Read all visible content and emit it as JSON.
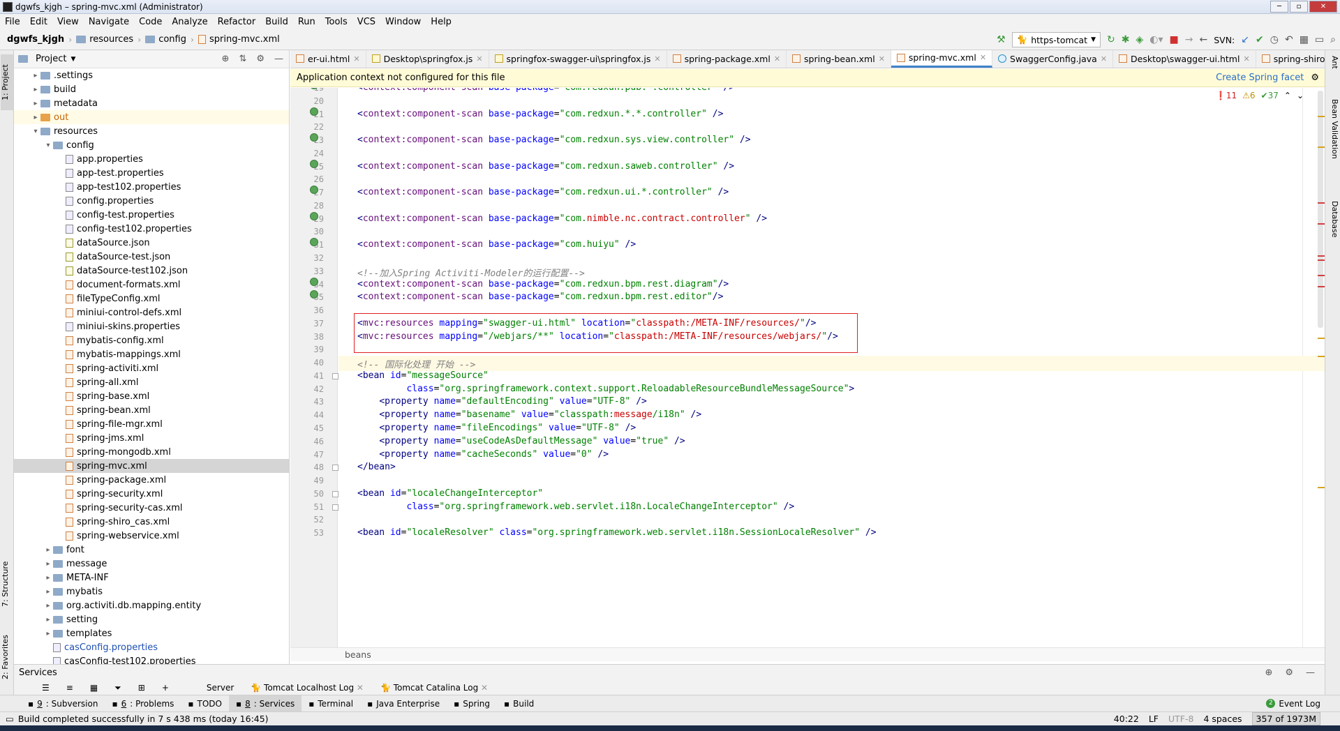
{
  "window": {
    "title": "dgwfs_kjgh – spring-mvc.xml (Administrator)"
  },
  "menu": [
    "File",
    "Edit",
    "View",
    "Navigate",
    "Code",
    "Analyze",
    "Refactor",
    "Build",
    "Run",
    "Tools",
    "VCS",
    "Window",
    "Help"
  ],
  "breadcrumb": {
    "project": "dgwfs_kjgh",
    "items": [
      "resources",
      "config",
      "spring-mvc.xml"
    ]
  },
  "toolbar": {
    "run_config": "https-tomcat",
    "svn_label": "SVN:"
  },
  "left_strip": {
    "project": "1: Project",
    "structure": "7: Structure",
    "favorites": "2: Favorites"
  },
  "right_strip": {
    "ant": "Ant",
    "bean_validation": "Bean Validation",
    "database": "Database"
  },
  "project_panel": {
    "title": "Project",
    "tree": [
      {
        "label": ".settings",
        "depth": 1,
        "type": "folder",
        "arrow": "▸"
      },
      {
        "label": "build",
        "depth": 1,
        "type": "folder",
        "arrow": "▸"
      },
      {
        "label": "metadata",
        "depth": 1,
        "type": "folder",
        "arrow": "▸"
      },
      {
        "label": "out",
        "depth": 1,
        "type": "folder-or",
        "arrow": "▸",
        "cls": "out"
      },
      {
        "label": "resources",
        "depth": 1,
        "type": "folder",
        "arrow": "▾"
      },
      {
        "label": "config",
        "depth": 2,
        "type": "folder",
        "arrow": "▾"
      },
      {
        "label": "app.properties",
        "depth": 3,
        "type": "prop"
      },
      {
        "label": "app-test.properties",
        "depth": 3,
        "type": "prop"
      },
      {
        "label": "app-test102.properties",
        "depth": 3,
        "type": "prop"
      },
      {
        "label": "config.properties",
        "depth": 3,
        "type": "prop"
      },
      {
        "label": "config-test.properties",
        "depth": 3,
        "type": "prop"
      },
      {
        "label": "config-test102.properties",
        "depth": 3,
        "type": "prop"
      },
      {
        "label": "dataSource.json",
        "depth": 3,
        "type": "json"
      },
      {
        "label": "dataSource-test.json",
        "depth": 3,
        "type": "json"
      },
      {
        "label": "dataSource-test102.json",
        "depth": 3,
        "type": "json"
      },
      {
        "label": "document-formats.xml",
        "depth": 3,
        "type": "xml"
      },
      {
        "label": "fileTypeConfig.xml",
        "depth": 3,
        "type": "xml"
      },
      {
        "label": "miniui-control-defs.xml",
        "depth": 3,
        "type": "xml"
      },
      {
        "label": "miniui-skins.properties",
        "depth": 3,
        "type": "prop"
      },
      {
        "label": "mybatis-config.xml",
        "depth": 3,
        "type": "xml"
      },
      {
        "label": "mybatis-mappings.xml",
        "depth": 3,
        "type": "xml"
      },
      {
        "label": "spring-activiti.xml",
        "depth": 3,
        "type": "xml"
      },
      {
        "label": "spring-all.xml",
        "depth": 3,
        "type": "xml"
      },
      {
        "label": "spring-base.xml",
        "depth": 3,
        "type": "xml"
      },
      {
        "label": "spring-bean.xml",
        "depth": 3,
        "type": "xml"
      },
      {
        "label": "spring-file-mgr.xml",
        "depth": 3,
        "type": "xml"
      },
      {
        "label": "spring-jms.xml",
        "depth": 3,
        "type": "xml"
      },
      {
        "label": "spring-mongodb.xml",
        "depth": 3,
        "type": "xml"
      },
      {
        "label": "spring-mvc.xml",
        "depth": 3,
        "type": "xml",
        "cls": "sel"
      },
      {
        "label": "spring-package.xml",
        "depth": 3,
        "type": "xml"
      },
      {
        "label": "spring-security.xml",
        "depth": 3,
        "type": "xml"
      },
      {
        "label": "spring-security-cas.xml",
        "depth": 3,
        "type": "xml"
      },
      {
        "label": "spring-shiro_cas.xml",
        "depth": 3,
        "type": "xml"
      },
      {
        "label": "spring-webservice.xml",
        "depth": 3,
        "type": "xml"
      },
      {
        "label": "font",
        "depth": 2,
        "type": "folder",
        "arrow": "▸"
      },
      {
        "label": "message",
        "depth": 2,
        "type": "folder",
        "arrow": "▸"
      },
      {
        "label": "META-INF",
        "depth": 2,
        "type": "folder",
        "arrow": "▸"
      },
      {
        "label": "mybatis",
        "depth": 2,
        "type": "folder",
        "arrow": "▸"
      },
      {
        "label": "org.activiti.db.mapping.entity",
        "depth": 2,
        "type": "folder",
        "arrow": "▸"
      },
      {
        "label": "setting",
        "depth": 2,
        "type": "folder",
        "arrow": "▸"
      },
      {
        "label": "templates",
        "depth": 2,
        "type": "folder",
        "arrow": "▸"
      },
      {
        "label": "casConfig.properties",
        "depth": 2,
        "type": "prop",
        "cls": "blue"
      },
      {
        "label": "casConfig-test102.properties",
        "depth": 2,
        "type": "prop"
      }
    ]
  },
  "tabs": [
    {
      "label": "er-ui.html",
      "type": "xml"
    },
    {
      "label": "Desktop\\springfox.js",
      "type": "js"
    },
    {
      "label": "springfox-swagger-ui\\springfox.js",
      "type": "js"
    },
    {
      "label": "spring-package.xml",
      "type": "xml"
    },
    {
      "label": "spring-bean.xml",
      "type": "xml"
    },
    {
      "label": "spring-mvc.xml",
      "type": "xml",
      "active": true
    },
    {
      "label": "SwaggerConfig.java",
      "type": "jv"
    },
    {
      "label": "Desktop\\swagger-ui.html",
      "type": "xml"
    },
    {
      "label": "spring-shiro_cas.xml",
      "type": "xml"
    }
  ],
  "banner": {
    "message": "Application context not configured for this file",
    "link": "Create Spring facet"
  },
  "inspections": {
    "errors": "11",
    "warnings": "6",
    "ok": "37"
  },
  "code_lines": [
    {
      "n": "19",
      "icon": true,
      "html": "<span class='tag'>&lt;</span><span class='ns'>context:component-scan</span> <span class='at'>base-package</span>=<span class='val'>\"com.redxun.pub.*.controller\"</span> <span class='tag'>/&gt;</span>"
    },
    {
      "n": "20",
      "html": ""
    },
    {
      "n": "21",
      "icon": true,
      "html": "<span class='tag'>&lt;</span><span class='ns'>context:component-scan</span> <span class='at'>base-package</span>=<span class='val'>\"com.redxun.*.*.controller\"</span> <span class='tag'>/&gt;</span>"
    },
    {
      "n": "22",
      "html": ""
    },
    {
      "n": "23",
      "icon": true,
      "html": "<span class='tag'>&lt;</span><span class='ns'>context:component-scan</span> <span class='at'>base-package</span>=<span class='val'>\"com.redxun.sys.view.controller\"</span> <span class='tag'>/&gt;</span>"
    },
    {
      "n": "24",
      "html": ""
    },
    {
      "n": "25",
      "icon": true,
      "html": "<span class='tag'>&lt;</span><span class='ns'>context:component-scan</span> <span class='at'>base-package</span>=<span class='val'>\"com.redxun.saweb.controller\"</span> <span class='tag'>/&gt;</span>"
    },
    {
      "n": "26",
      "html": ""
    },
    {
      "n": "27",
      "icon": true,
      "html": "<span class='tag'>&lt;</span><span class='ns'>context:component-scan</span> <span class='at'>base-package</span>=<span class='val'>\"com.redxun.ui.*.controller\"</span> <span class='tag'>/&gt;</span>"
    },
    {
      "n": "28",
      "html": ""
    },
    {
      "n": "29",
      "icon": true,
      "html": "<span class='tag'>&lt;</span><span class='ns'>context:component-scan</span> <span class='at'>base-package</span>=<span class='val'>\"com.<span class='red'>nimble.nc.contract.controller</span>\"</span> <span class='tag'>/&gt;</span>"
    },
    {
      "n": "30",
      "html": ""
    },
    {
      "n": "31",
      "icon": true,
      "html": "<span class='tag'>&lt;</span><span class='ns'>context:component-scan</span> <span class='at'>base-package</span>=<span class='val'>\"com.huiyu\"</span> <span class='tag'>/&gt;</span>"
    },
    {
      "n": "32",
      "html": ""
    },
    {
      "n": "33",
      "html": "<span class='cm'>&lt;!--加入Spring Activiti-Modeler的运行配置--&gt;</span>"
    },
    {
      "n": "34",
      "icon": true,
      "html": "<span class='tag'>&lt;</span><span class='ns'>context:component-scan</span> <span class='at'>base-package</span>=<span class='val'>\"com.redxun.bpm.rest.diagram\"</span><span class='tag'>/&gt;</span>"
    },
    {
      "n": "35",
      "icon": true,
      "html": "<span class='tag'>&lt;</span><span class='ns'>context:component-scan</span> <span class='at'>base-package</span>=<span class='val'>\"com.redxun.bpm.rest.editor\"</span><span class='tag'>/&gt;</span>"
    },
    {
      "n": "36",
      "html": ""
    },
    {
      "n": "37",
      "html": "<span class='tag'>&lt;</span><span class='ns'>mvc:resources</span> <span class='at'>mapping</span>=<span class='val'>\"swagger-ui.html\"</span> <span class='at'>location</span>=<span class='val'>\"<span class='red'>classpath:/META-INF/resources/</span>\"</span><span class='tag'>/&gt;</span>"
    },
    {
      "n": "38",
      "html": "<span class='tag'>&lt;</span><span class='ns'>mvc:resources</span> <span class='at'>mapping</span>=<span class='val'>\"/webjars/**\"</span> <span class='at'>location</span>=<span class='val'>\"<span class='red'>classpath:/META-INF/resources/webjars/</span>\"</span><span class='tag'>/&gt;</span>"
    },
    {
      "n": "39",
      "html": ""
    },
    {
      "n": "40",
      "current": true,
      "html": "<span class='cm'>&lt;!-- 国际化处理 开始 --&gt;</span>"
    },
    {
      "n": "41",
      "fold": true,
      "html": "<span class='tag'>&lt;bean</span> <span class='at'>id</span>=<span class='val'>\"messageSource\"</span>"
    },
    {
      "n": "42",
      "html": "         <span class='at'>class</span>=<span class='val'>\"org.springframework.context.support.ReloadableResourceBundleMessageSource\"</span><span class='tag'>&gt;</span>"
    },
    {
      "n": "43",
      "html": "    <span class='tag'>&lt;property</span> <span class='at'>name</span>=<span class='val'>\"defaultEncoding\"</span> <span class='at'>value</span>=<span class='val'>\"UTF-8\"</span> <span class='tag'>/&gt;</span>"
    },
    {
      "n": "44",
      "html": "    <span class='tag'>&lt;property</span> <span class='at'>name</span>=<span class='val'>\"basename\"</span> <span class='at'>value</span>=<span class='val'>\"classpath:<span class='red'>message</span>/i18n\"</span> <span class='tag'>/&gt;</span>"
    },
    {
      "n": "45",
      "html": "    <span class='tag'>&lt;property</span> <span class='at'>name</span>=<span class='val'>\"fileEncodings\"</span> <span class='at'>value</span>=<span class='val'>\"UTF-8\"</span> <span class='tag'>/&gt;</span>"
    },
    {
      "n": "46",
      "html": "    <span class='tag'>&lt;property</span> <span class='at'>name</span>=<span class='val'>\"useCodeAsDefaultMessage\"</span> <span class='at'>value</span>=<span class='val'>\"true\"</span> <span class='tag'>/&gt;</span>"
    },
    {
      "n": "47",
      "html": "    <span class='tag'>&lt;property</span> <span class='at'>name</span>=<span class='val'>\"cacheSeconds\"</span> <span class='at'>value</span>=<span class='val'>\"0\"</span> <span class='tag'>/&gt;</span>"
    },
    {
      "n": "48",
      "fold": true,
      "html": "<span class='tag'>&lt;/bean&gt;</span>"
    },
    {
      "n": "49",
      "html": ""
    },
    {
      "n": "50",
      "fold": true,
      "html": "<span class='tag'>&lt;bean</span> <span class='at'>id</span>=<span class='val'>\"localeChangeInterceptor\"</span>"
    },
    {
      "n": "51",
      "fold": true,
      "html": "         <span class='at'>class</span>=<span class='val'>\"org.springframework.web.servlet.i18n.LocaleChangeInterceptor\"</span> <span class='tag'>/&gt;</span>"
    },
    {
      "n": "52",
      "html": ""
    },
    {
      "n": "53",
      "html": "<span class='tag'>&lt;bean</span> <span class='at'>id</span>=<span class='val'>\"localeResolver\"</span> <span class='at'>class</span>=<span class='val'>\"org.springframework.web.servlet.i18n.SessionLocaleResolver\"</span> <span class='tag'>/&gt;</span>"
    }
  ],
  "editor_breadcrumb": "beans",
  "services": {
    "title": "Services",
    "server": "Server",
    "tabs": [
      "Tomcat Localhost Log",
      "Tomcat Catalina Log"
    ]
  },
  "bottom_tabs": [
    {
      "key": "9",
      "label": ": Subversion"
    },
    {
      "key": "6",
      "label": ": Problems"
    },
    {
      "key": "",
      "label": "TODO"
    },
    {
      "key": "8",
      "label": ": Services",
      "active": true
    },
    {
      "key": "",
      "label": "Terminal"
    },
    {
      "key": "",
      "label": "Java Enterprise"
    },
    {
      "key": "",
      "label": "Spring"
    },
    {
      "key": "",
      "label": "Build"
    }
  ],
  "event_log": "Event Log",
  "event_count": "2",
  "status": {
    "message": "Build completed successfully in 7 s 438 ms (today 16:45)",
    "position": "40:22",
    "line_sep": "LF",
    "encoding": "UTF-8",
    "indent": "4 spaces",
    "memory": "357 of 1973M"
  }
}
